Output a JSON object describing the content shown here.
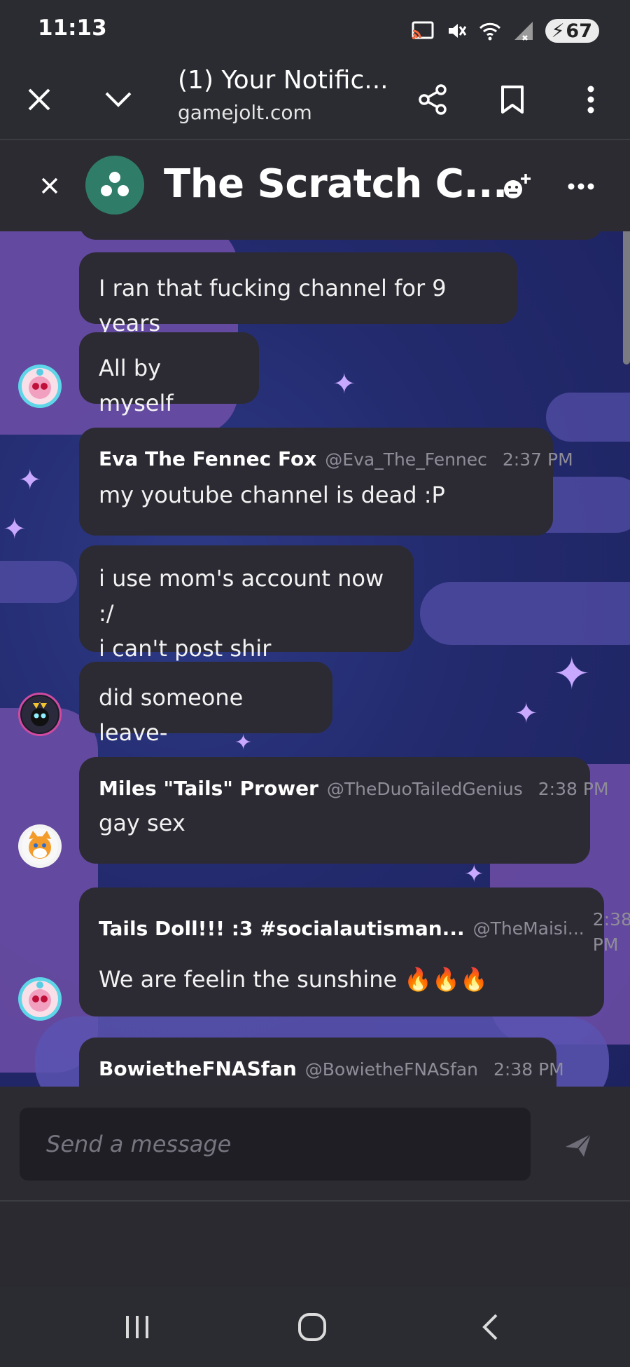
{
  "status_bar": {
    "time": "11:13",
    "battery": "67"
  },
  "browser": {
    "title": "(1) Your Notific...",
    "domain": "gamejolt.com"
  },
  "chat_header": {
    "title": "The Scratch C..."
  },
  "messages": {
    "m0": {
      "text": "I ran that fucking channel for 9 years"
    },
    "m1": {
      "text": "All by myself"
    },
    "m2": {
      "author": "Eva The Fennec Fox",
      "handle": "@Eva_The_Fennec",
      "time": "2:37 PM",
      "text": "my youtube channel is dead :P"
    },
    "m3": {
      "line1": "i use mom's account now :/",
      "line2": "i can't post shir"
    },
    "m4": {
      "text": "did someone leave-"
    },
    "m5": {
      "author": "Miles \"Tails\" Prower",
      "handle": "@TheDuoTailedGenius",
      "time": "2:38 PM",
      "text": "gay sex"
    },
    "m6": {
      "author": "Tails Doll!!! :3 #socialautisman...",
      "handle": "@TheMaisi...",
      "time_line1": "2:38",
      "time_line2": "PM",
      "text": "We are feelin the sunshine 🔥🔥🔥"
    },
    "m7": {
      "author": "BowietheFNASfan",
      "handle": "@BowietheFNASfan",
      "time": "2:38 PM"
    }
  },
  "composer": {
    "placeholder": "Send a message"
  },
  "colors": {
    "group_avatar": "#2f7d68",
    "bubble": "#2c2b33",
    "chat_bg": "#232a6d"
  }
}
